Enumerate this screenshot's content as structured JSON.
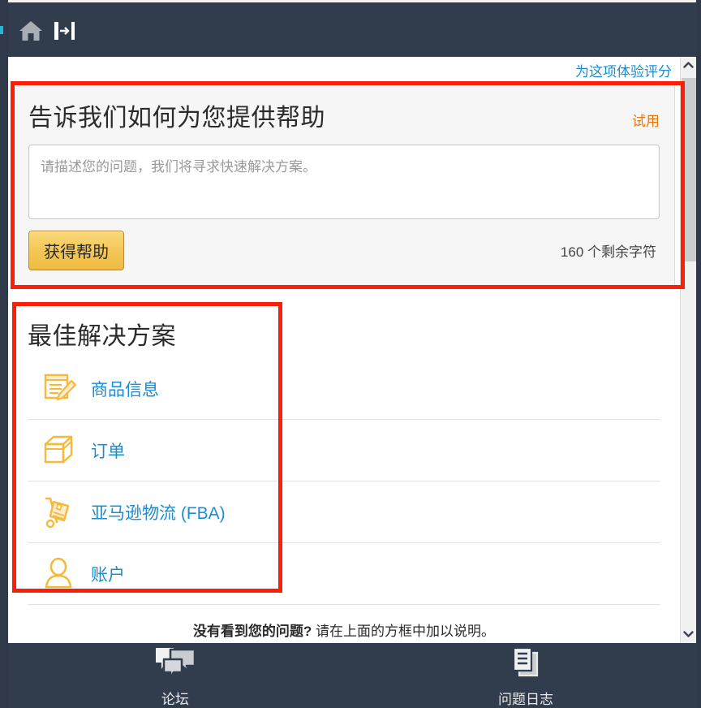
{
  "topbar": {
    "home_icon": "home-icon",
    "collapse_icon": "collapse-panel-icon"
  },
  "content": {
    "rate_link": "为这项体验评分"
  },
  "help_card": {
    "title": "告诉我们如何为您提供帮助",
    "trial_link": "试用",
    "textarea_placeholder": "请描述您的问题，我们将寻求快速解决方案。",
    "textarea_value": "",
    "submit_label": "获得帮助",
    "char_count": "160 个剩余字符"
  },
  "solutions": {
    "title": "最佳解决方案",
    "items": [
      {
        "label": "商品信息",
        "icon": "listing-edit-icon"
      },
      {
        "label": "订单",
        "icon": "box-icon"
      },
      {
        "label": "亚马逊物流 (FBA)",
        "icon": "hand-truck-icon"
      },
      {
        "label": "账户",
        "icon": "person-icon"
      }
    ],
    "not_found_bold": "没有看到您的问题?",
    "not_found_rest": " 请在上面的方框中加以说明。"
  },
  "bottom_nav": [
    {
      "label": "论坛",
      "icon": "chat-bubbles-icon"
    },
    {
      "label": "问题日志",
      "icon": "documents-icon"
    }
  ],
  "colors": {
    "chrome": "#313c4d",
    "link": "#1a8cd0",
    "accent_orange": "#e47911",
    "button_yellow": "#f3c758",
    "icon_yellow": "#f6b93b",
    "annotation_red": "#fb1e09"
  }
}
